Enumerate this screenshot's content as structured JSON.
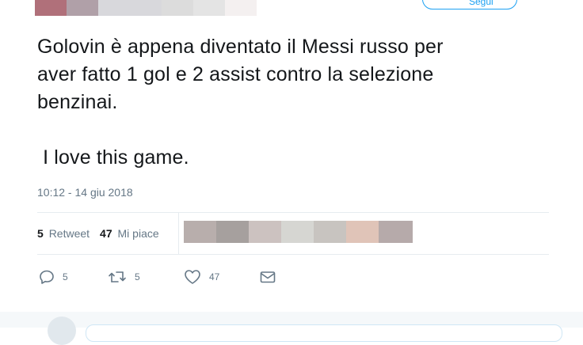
{
  "follow_button": {
    "label": "Segui"
  },
  "tweet": {
    "lines": [
      "Golovin è appena diventato il Messi russo per",
      "aver fatto 1 gol e 2 assist contro la selezione",
      "benzinai.",
      "",
      " I love this game."
    ],
    "timestamp": "10:12 - 14 giu 2018"
  },
  "stats": {
    "retweets_count": "5",
    "retweets_label": "Retweet",
    "likes_count": "47",
    "likes_label": "Mi piace"
  },
  "actions": {
    "reply_count": "5",
    "retweet_count": "5",
    "like_count": "47",
    "message_count": ""
  },
  "colors": {
    "text": "#14171a",
    "secondary": "#657786",
    "accent": "#1da1f2",
    "divider": "#e6ecf0"
  },
  "header_blur_colors": [
    "#b0707a",
    "#b0a0a8",
    "#d8d8dc",
    "#d8d8dc",
    "#dcdcdc",
    "#e4e4e4",
    "#f4f0f0"
  ],
  "liker_avatar_colors": [
    "#b8aeac",
    "#a6a09e",
    "#ccc2c0",
    "#d6d6d2",
    "#c8c4c0",
    "#e0c4b8",
    "#b6aaaa"
  ]
}
